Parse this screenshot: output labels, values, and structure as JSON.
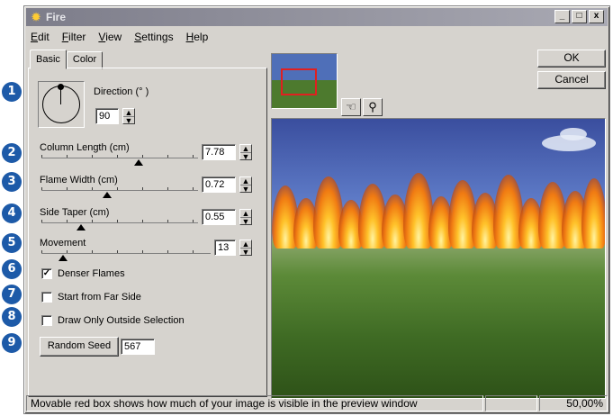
{
  "window": {
    "title": "Fire",
    "minimize": "_",
    "maximize": "□",
    "close": "x"
  },
  "menu": [
    "Edit",
    "Filter",
    "View",
    "Settings",
    "Help"
  ],
  "tabs": [
    "Basic",
    "Color"
  ],
  "badges": [
    "1",
    "2",
    "3",
    "4",
    "5",
    "6",
    "7",
    "8",
    "9"
  ],
  "direction": {
    "label": "Direction (° )",
    "value": "90"
  },
  "column_length": {
    "label": "Column Length (cm)",
    "value": "7.78",
    "level": 0.62
  },
  "flame_width": {
    "label": "Flame Width (cm)",
    "value": "0.72",
    "level": 0.42
  },
  "side_taper": {
    "label": "Side Taper (cm)",
    "value": "0.55",
    "level": 0.25
  },
  "movement": {
    "label": "Movement",
    "value": "13",
    "level": 0.13
  },
  "options": [
    {
      "label": "Denser Flames",
      "checked": true,
      "mark": "✓"
    },
    {
      "label": "Start from Far Side",
      "checked": false,
      "mark": ""
    },
    {
      "label": "Draw Only Outside Selection",
      "checked": false,
      "mark": ""
    }
  ],
  "random_seed": {
    "button": "Random Seed",
    "value": "567"
  },
  "buttons": {
    "ok": "OK",
    "cancel": "Cancel"
  },
  "tools": {
    "hand": "☜",
    "zoom": "⚲"
  },
  "spin": {
    "up": "▲",
    "down": "▼"
  },
  "status": {
    "message": "Movable red box shows how much of your image is visible in the preview window",
    "zoom": "50,00%"
  },
  "colors": {
    "badge": "#1d5aa8",
    "nav_box": "#e02020"
  }
}
